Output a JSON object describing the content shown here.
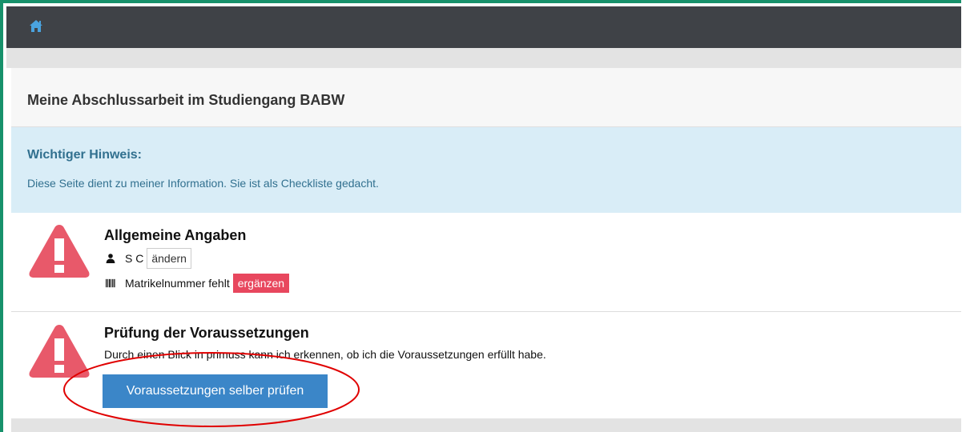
{
  "navbar": {
    "home_icon": "home-icon"
  },
  "page": {
    "title": "Meine Abschlussarbeit im Studiengang BABW"
  },
  "notice": {
    "title": "Wichtiger Hinweis:",
    "text": "Diese Seite dient zu meiner Information. Sie ist als Checkliste gedacht."
  },
  "general": {
    "heading": "Allgemeine Angaben",
    "user_name": "S C",
    "change_label": "ändern",
    "matriculation_text": "Matrikelnummer fehlt",
    "add_label": "ergänzen"
  },
  "requirements": {
    "heading": "Prüfung der Voraussetzungen",
    "text": "Durch einen Blick in primuss kann ich erkennen, ob ich die Voraussetzungen erfüllt habe.",
    "button_label": "Voraussetzungen selber prüfen"
  },
  "colors": {
    "navbar": "#3f4247",
    "accent_border": "#17916b",
    "alert_bg": "#d9edf7",
    "alert_text": "#31708f",
    "warning": "#e8596a",
    "danger": "#e8475e",
    "primary": "#3b86c8",
    "annotation": "#e00000"
  }
}
